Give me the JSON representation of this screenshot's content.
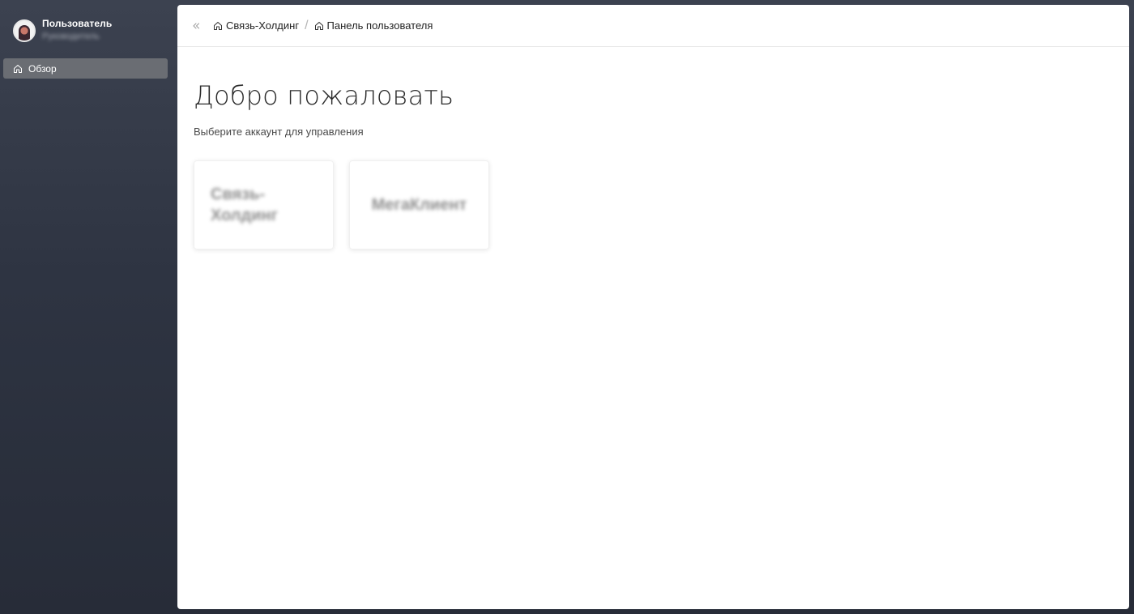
{
  "sidebar": {
    "user": {
      "name": "Пользователь",
      "role": "Руководитель"
    },
    "items": [
      {
        "label": "Обзор",
        "icon": "home-icon",
        "active": true
      }
    ]
  },
  "topbar": {
    "collapse_icon": "double-chevron-left-icon",
    "breadcrumbs": [
      {
        "label": "Связь-Холдинг",
        "icon": "home-icon"
      },
      {
        "label": "Панель пользователя",
        "icon": "home-icon"
      }
    ],
    "separator": "/"
  },
  "main": {
    "title": "Добро пожаловать",
    "subtitle": "Выберите аккаунт для управления",
    "accounts": [
      {
        "label": "Связь-Холдинг"
      },
      {
        "label": "МегаКлиент"
      }
    ]
  },
  "colors": {
    "sidebar_bg": "#2e3442",
    "active_item_bg": "#6a6d73",
    "panel_bg": "#ffffff"
  }
}
